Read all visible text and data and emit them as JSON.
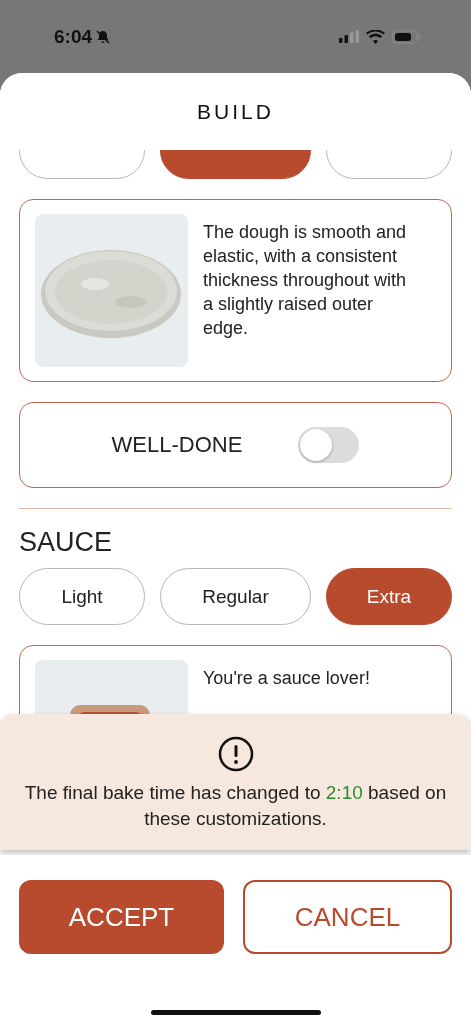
{
  "status_bar": {
    "time": "6:04"
  },
  "sheet": {
    "title": "BUILD"
  },
  "crust_options": [
    {
      "selected": false
    },
    {
      "selected": true
    },
    {
      "selected": false
    }
  ],
  "crust_card": {
    "description": "The dough is smooth and elastic, with a consistent thickness throughout with a slightly raised outer edge."
  },
  "well_done": {
    "label": "WELL-DONE",
    "on": false
  },
  "sauce": {
    "heading": "SAUCE",
    "options": [
      {
        "label": "Light",
        "selected": false
      },
      {
        "label": "Regular",
        "selected": false
      },
      {
        "label": "Extra",
        "selected": true
      }
    ],
    "card": {
      "description": "You're a sauce lover!"
    }
  },
  "notice": {
    "before": "The final bake time has changed to",
    "highlight": "2:10",
    "after": "based on these customizations."
  },
  "buttons": [
    {
      "label": "ACCEPT",
      "kind": "primary"
    },
    {
      "label": "CANCEL",
      "kind": "secondary"
    }
  ]
}
